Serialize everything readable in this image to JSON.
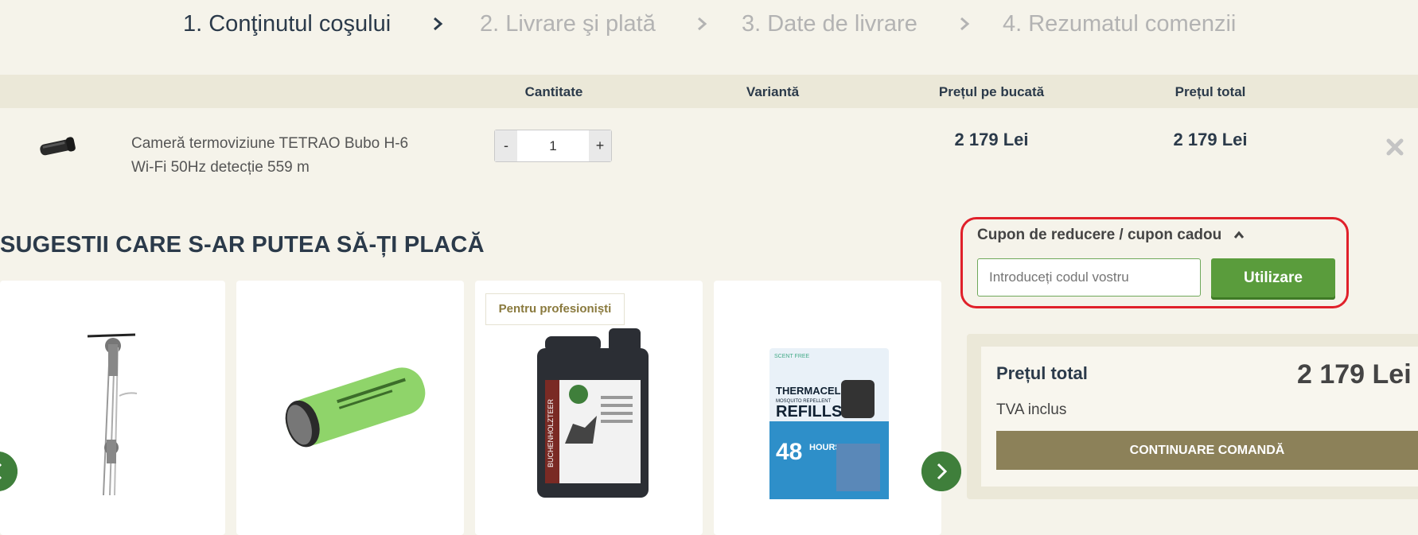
{
  "steps": [
    {
      "label": "1. Conţinutul coşului",
      "active": true
    },
    {
      "label": "2. Livrare şi plată",
      "active": false
    },
    {
      "label": "3. Date de livrare",
      "active": false
    },
    {
      "label": "4. Rezumatul comenzii",
      "active": false
    }
  ],
  "table": {
    "headers": {
      "quantity": "Cantitate",
      "variant": "Variantă",
      "unit_price": "Prețul pe bucată",
      "total_price": "Prețul total"
    },
    "rows": [
      {
        "name": "Cameră termoviziune TETRAO Bubo H-6 Wi-Fi 50Hz detecție 559 m",
        "quantity": "1",
        "minus": "-",
        "plus": "+",
        "unit_price": "2 179 Lei",
        "total_price": "2 179 Lei",
        "remove_icon": "close-icon"
      }
    ]
  },
  "suggestions": {
    "title": "SUGESTII CARE S-AR PUTEA SĂ-ȚI PLACĂ",
    "badge": "Pentru profesioniști",
    "product_label": "BUCHENHOLZTEER",
    "refill_texts": {
      "scent": "SCENT FREE",
      "brand": "THERMACELL",
      "line": "MOSQUITO REPELLENT",
      "refills": "REFILLS",
      "hours_num": "48",
      "hours": "HOURS"
    }
  },
  "coupon": {
    "title": "Cupon de reducere / cupon cadou",
    "placeholder": "Introduceți codul vostru",
    "button": "Utilizare"
  },
  "summary": {
    "total_label": "Prețul total",
    "total_value": "2 179 Lei",
    "vat": "TVA inclus",
    "continue": "CONTINUARE COMANDĂ"
  },
  "colors": {
    "background": "#f5f3ea",
    "header_band": "#ebe8d8",
    "accent_green": "#5a9c3c",
    "continue_button": "#8c8159",
    "highlight_red": "#e0202a"
  }
}
